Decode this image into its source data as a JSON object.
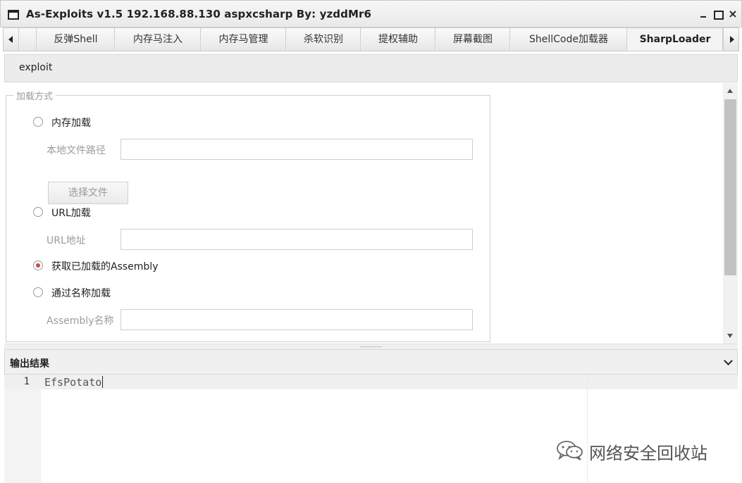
{
  "window": {
    "title": "As-Exploits v1.5 192.168.88.130 aspxcsharp By: yzddMr6",
    "controls": {
      "minimize_icon": "minimize-icon",
      "maximize_icon": "maximize-icon",
      "close_icon": "close-icon",
      "close_glyph": "×"
    }
  },
  "tabs": [
    {
      "label": "反弹Shell",
      "active": false
    },
    {
      "label": "内存马注入",
      "active": false
    },
    {
      "label": "内存马管理",
      "active": false
    },
    {
      "label": "杀软识别",
      "active": false
    },
    {
      "label": "提权辅助",
      "active": false
    },
    {
      "label": "屏幕截图",
      "active": false
    },
    {
      "label": "ShellCode加载器",
      "active": false
    },
    {
      "label": "SharpLoader",
      "active": true
    }
  ],
  "toolbar": {
    "exploit_label": "exploit"
  },
  "load_method": {
    "legend": "加载方式",
    "options": [
      {
        "label": "内存加载",
        "checked": false
      },
      {
        "label": "URL加载",
        "checked": false
      },
      {
        "label": "获取已加载的Assembly",
        "checked": true
      },
      {
        "label": "通过名称加载",
        "checked": false
      }
    ],
    "local_path_label": "本地文件路径",
    "local_path_value": "",
    "choose_file_label": "选择文件",
    "url_label": "URL地址",
    "url_value": "",
    "assembly_name_label": "Assembly名称",
    "assembly_name_value": ""
  },
  "output": {
    "title": "输出结果",
    "lines": [
      {
        "number": "1",
        "text": "EfsPotato"
      }
    ]
  },
  "watermark": {
    "text": "网络安全回收站"
  },
  "colors": {
    "radio_checked": "#c94b4b",
    "accent": "#222222"
  }
}
